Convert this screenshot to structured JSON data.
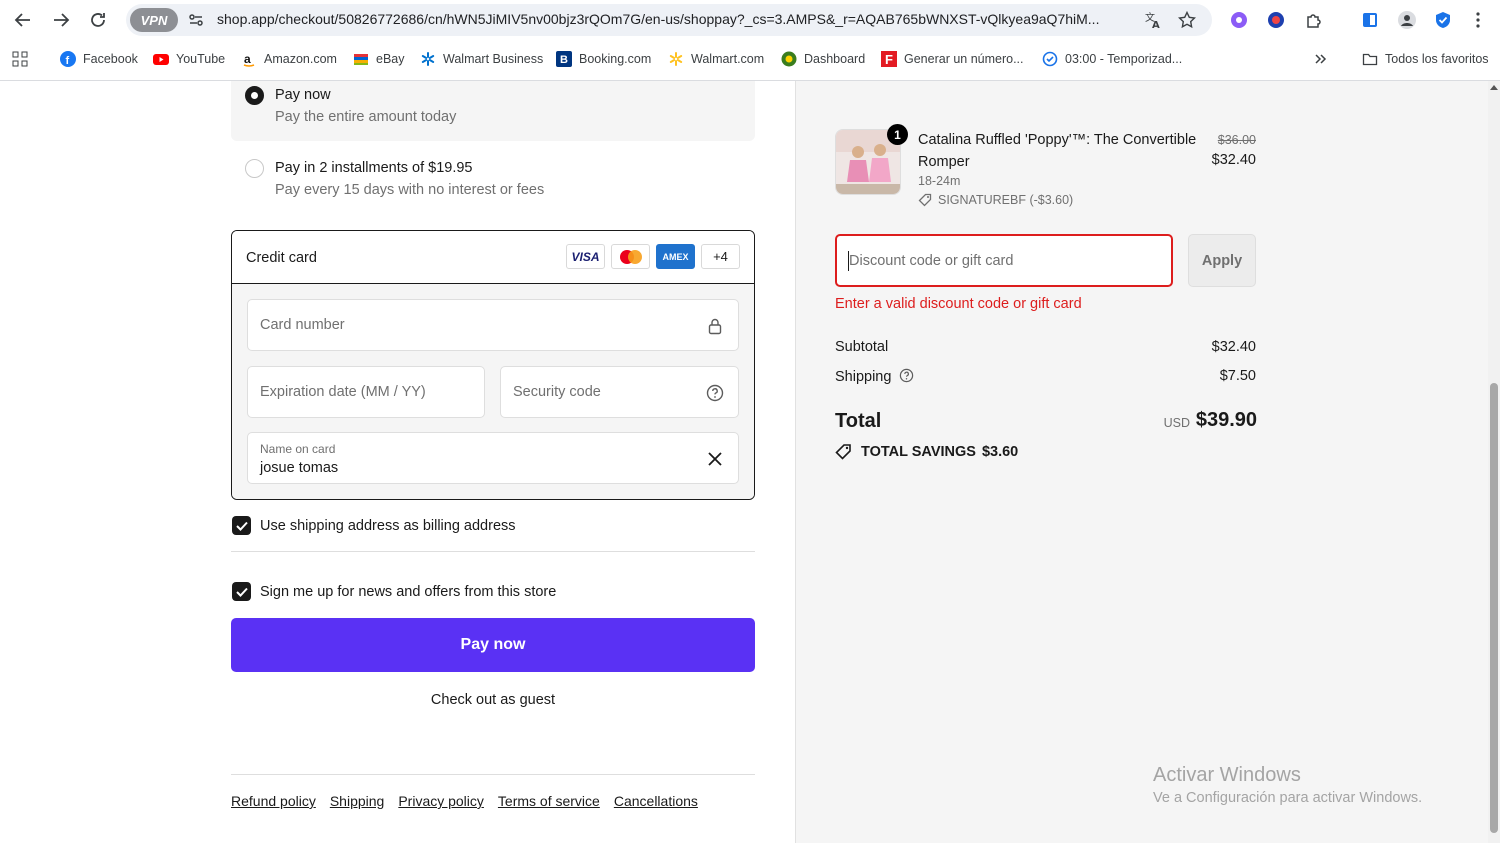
{
  "browser": {
    "url": "shop.app/checkout/50826772686/cn/hWN5JiMIV5nv00bjz3rQOm7G/en-us/shoppay?_cs=3.AMPS&_r=AQAB765bWNXST-vQlkyea9aQ7hiM...",
    "vpn_label": "VPN",
    "bookmarks": [
      {
        "label": "Facebook",
        "icon": "facebook-icon"
      },
      {
        "label": "YouTube",
        "icon": "youtube-icon"
      },
      {
        "label": "Amazon.com",
        "icon": "amazon-icon"
      },
      {
        "label": "eBay",
        "icon": "ebay-icon"
      },
      {
        "label": "Walmart Business",
        "icon": "walmart-icon"
      },
      {
        "label": "Booking.com",
        "icon": "booking-icon"
      },
      {
        "label": "Walmart.com",
        "icon": "walmart-icon"
      },
      {
        "label": "Dashboard",
        "icon": "dashboard-icon"
      },
      {
        "label": "Generar un número...",
        "icon": "f-icon"
      },
      {
        "label": "03:00 - Temporizad...",
        "icon": "timer-icon"
      }
    ],
    "all_bookmarks": "Todos los favoritos"
  },
  "payment": {
    "option1_title": "Pay now",
    "option1_sub": "Pay the entire amount today",
    "option2_title": "Pay in 2 installments of $19.95",
    "option2_sub": "Pay every 15 days with no interest or fees",
    "credit_card_title": "Credit card",
    "card_logos": [
      "VISA",
      "",
      "AMEX",
      "+4"
    ],
    "card_number_placeholder": "Card number",
    "expiration_placeholder": "Expiration date (MM / YY)",
    "security_placeholder": "Security code",
    "name_label": "Name on card",
    "name_value": "josue tomas",
    "billing_label": "Use shipping address as billing address",
    "news_label": "Sign me up for news and offers from this store",
    "pay_button": "Pay now",
    "guest_link": "Check out as guest",
    "footer": [
      "Refund policy",
      "Shipping",
      "Privacy policy",
      "Terms of service",
      "Cancellations"
    ]
  },
  "summary": {
    "quantity": "1",
    "product_name": "Catalina Ruffled 'Poppy'™: The Convertible Romper",
    "variant": "18-24m",
    "discount_code": "SIGNATUREBF (-$3.60)",
    "original_price": "$36.00",
    "price": "$32.40",
    "discount_placeholder": "Discount code or gift card",
    "apply_button": "Apply",
    "error": "Enter a valid discount code or gift card",
    "subtotal_label": "Subtotal",
    "subtotal_value": "$32.40",
    "shipping_label": "Shipping",
    "shipping_value": "$7.50",
    "total_label": "Total",
    "currency": "USD",
    "total_value": "$39.90",
    "savings_label": "TOTAL SAVINGS",
    "savings_value": "$3.60"
  },
  "watermark": {
    "line1": "Activar Windows",
    "line2": "Ve a Configuración para activar Windows."
  },
  "colors": {
    "accent": "#5a31f4",
    "error": "#dd1d1d"
  }
}
